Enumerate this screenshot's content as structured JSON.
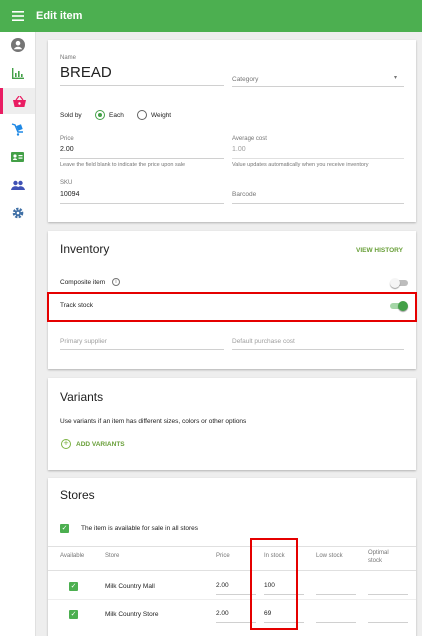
{
  "header": {
    "title": "Edit item",
    "menu_icon": "hamburger-icon"
  },
  "rail": {
    "icons": [
      "account-icon",
      "reports-icon",
      "items-basket-icon",
      "inventory-cart-icon",
      "employees-badge-icon",
      "customers-icon",
      "settings-gear-icon"
    ],
    "active": "items-basket-icon"
  },
  "item_form": {
    "name_label": "Name",
    "name_value": "BREAD",
    "category_placeholder": "Category",
    "sold_by_label": "Sold by",
    "sold_by_options": [
      "Each",
      "Weight"
    ],
    "sold_by_selected": "Each",
    "price_label": "Price",
    "price_value": "2.00",
    "price_hint": "Leave the field blank to indicate the price upon sale",
    "average_cost_label": "Average cost",
    "average_cost_value": "1.00",
    "average_cost_hint": "Value updates automatically when you receive inventory",
    "sku_label": "SKU",
    "sku_value": "10094",
    "barcode_placeholder": "Barcode"
  },
  "inventory": {
    "title": "Inventory",
    "view_history": "VIEW HISTORY",
    "composite_label": "Composite item",
    "composite_on": false,
    "track_stock_label": "Track stock",
    "track_stock_on": true,
    "primary_supplier_placeholder": "Primary supplier",
    "default_purchase_cost_placeholder": "Default purchase cost"
  },
  "variants": {
    "title": "Variants",
    "description": "Use variants if an item has different sizes, colors or other options",
    "add_label": "ADD VARIANTS"
  },
  "stores": {
    "title": "Stores",
    "available_all_label": "The item is available for sale in all stores",
    "columns": [
      "Available",
      "Store",
      "Price",
      "In stock",
      "Low stock",
      "Optimal stock"
    ],
    "rows": [
      {
        "available": true,
        "store": "Milk Country Mall",
        "price": "2.00",
        "in_stock": "100",
        "low_stock": "",
        "optimal_stock": ""
      },
      {
        "available": true,
        "store": "Milk Country Store",
        "price": "2.00",
        "in_stock": "69",
        "low_stock": "",
        "optimal_stock": ""
      }
    ]
  },
  "colors": {
    "accent_green": "#4caf50",
    "active_pink": "#e91e63",
    "highlight_red": "#e50000"
  }
}
